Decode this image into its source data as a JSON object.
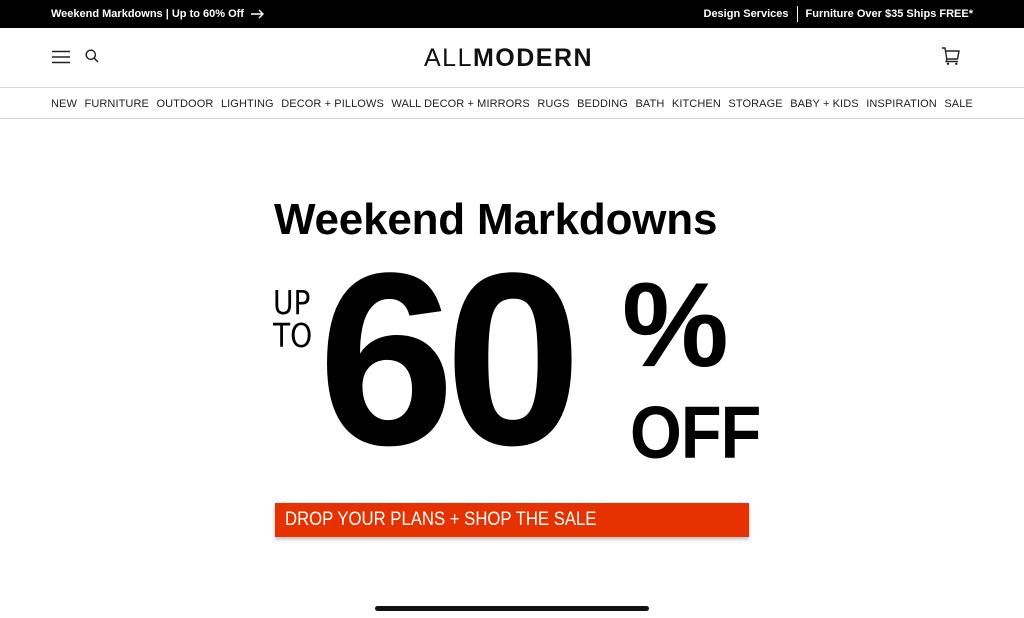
{
  "topbar": {
    "promo": "Weekend Markdowns | Up to 60% Off",
    "design_services": "Design Services",
    "shipping": "Furniture Over $35 Ships FREE*"
  },
  "header": {
    "logo_light": "ALL",
    "logo_bold": "MODERN"
  },
  "nav": {
    "items": [
      "NEW",
      "FURNITURE",
      "OUTDOOR",
      "LIGHTING",
      "DECOR + PILLOWS",
      "WALL DECOR + MIRRORS",
      "RUGS",
      "BEDDING",
      "BATH",
      "KITCHEN",
      "STORAGE",
      "BABY + KIDS",
      "INSPIRATION",
      "SALE"
    ]
  },
  "hero": {
    "title": "Weekend Markdowns",
    "up": "UP",
    "to": "TO",
    "number": "60",
    "percent": "%",
    "off": "OFF",
    "cta": "DROP YOUR PLANS + SHOP THE SALE"
  },
  "colors": {
    "topbar_bg": "#000000",
    "cta_bg": "#e63200"
  },
  "icons": {
    "menu": "hamburger-icon",
    "search": "search-icon",
    "cart": "cart-icon",
    "arrow": "arrow-right-icon"
  }
}
